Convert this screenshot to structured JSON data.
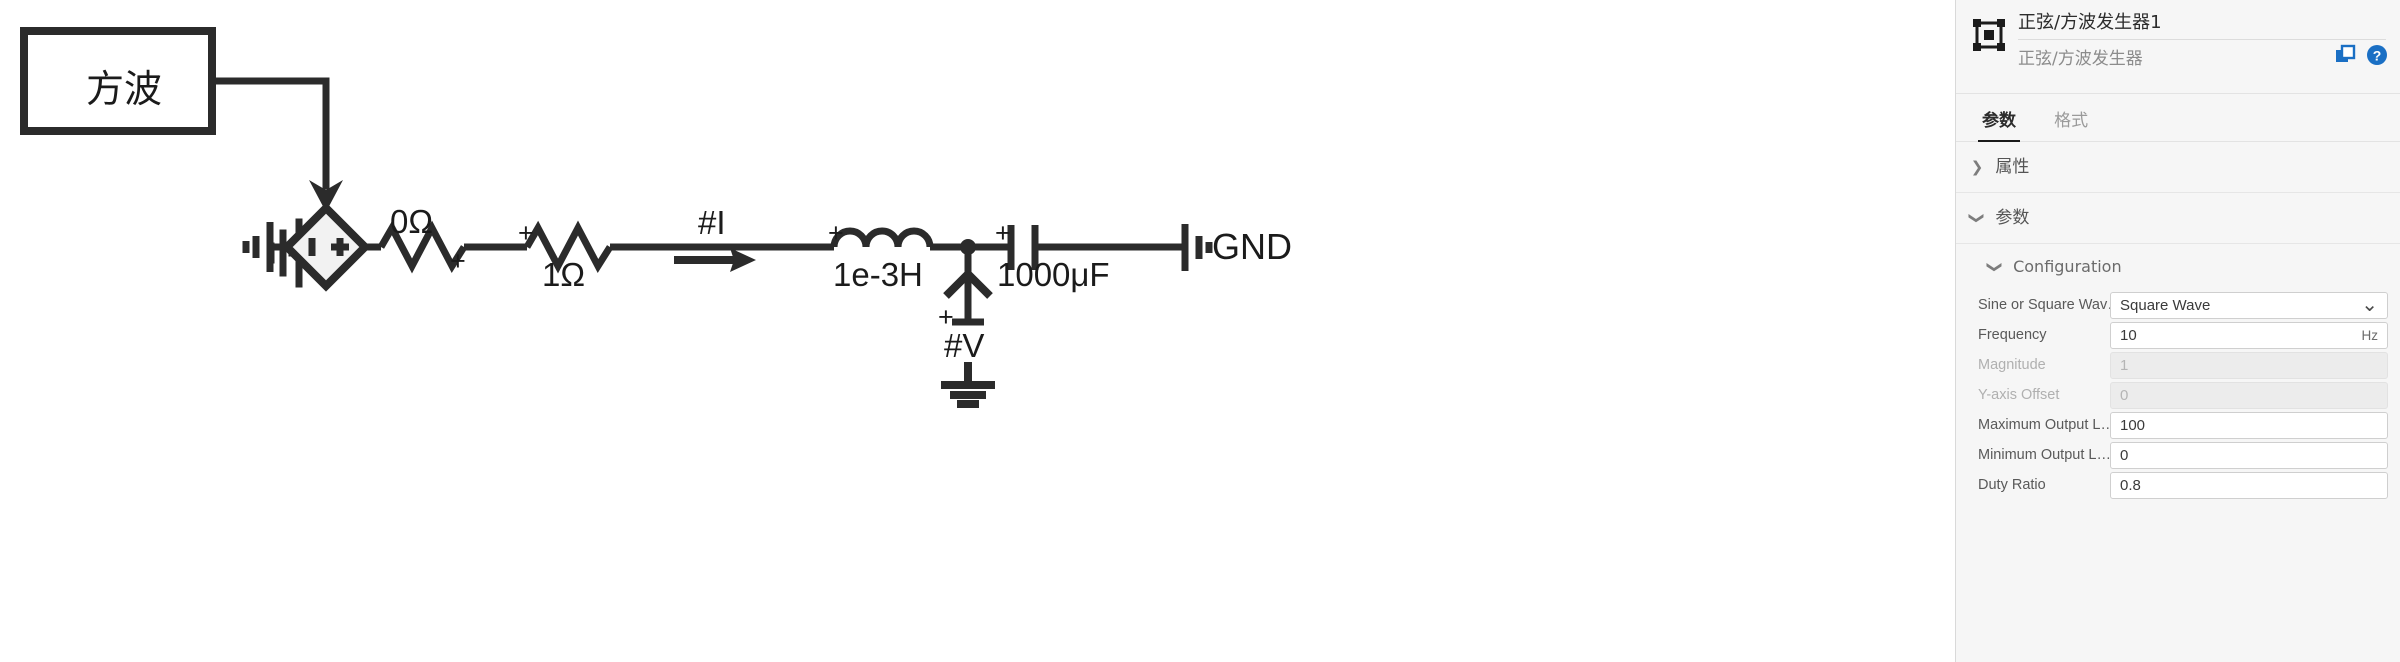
{
  "canvas": {
    "source_block": {
      "label": "方波"
    },
    "components": [
      {
        "name": "voltage-source",
        "symbol": "diamond",
        "inner": "−|+"
      },
      {
        "name": "resistor-0ohm",
        "value_label": "0Ω",
        "polarity": "+"
      },
      {
        "name": "resistor-1ohm",
        "value_label": "1Ω",
        "polarity": "+"
      },
      {
        "name": "current-probe",
        "label": "#I"
      },
      {
        "name": "inductor",
        "value_label": "1e-3H",
        "polarity": "+"
      },
      {
        "name": "capacitor",
        "value_label": "1000μF",
        "polarity": "+"
      },
      {
        "name": "voltage-probe",
        "label": "#V",
        "polarity": "+"
      },
      {
        "name": "ground-right",
        "label": "GND"
      }
    ],
    "labels": {
      "r0": "0Ω",
      "r1": "1Ω",
      "current": "#I",
      "inductor": "1e-3H",
      "capacitor": "1000μF",
      "voltage": "#V",
      "gnd": "GND",
      "plus": "+"
    }
  },
  "panel": {
    "header": {
      "icon": "component-block-icon",
      "title": "正弦/方波发生器1",
      "subtitle": "正弦/方波发生器",
      "actions": [
        {
          "name": "duplicate-icon",
          "label": "duplicate"
        },
        {
          "name": "help-icon",
          "label": "help"
        }
      ]
    },
    "tabs": [
      {
        "label": "参数",
        "active": true
      },
      {
        "label": "格式",
        "active": false
      }
    ],
    "sections": [
      {
        "name": "properties",
        "label": "属性",
        "expanded": false
      },
      {
        "name": "parameters",
        "label": "参数",
        "expanded": true
      },
      {
        "name": "configuration",
        "label": "Configuration",
        "expanded": true
      }
    ],
    "params": [
      {
        "label": "Sine or Square Wav…",
        "value": "Square Wave",
        "unit": "",
        "type": "select",
        "disabled": false
      },
      {
        "label": "Frequency",
        "value": "10",
        "unit": "Hz",
        "type": "text",
        "disabled": false
      },
      {
        "label": "Magnitude",
        "value": "1",
        "unit": "",
        "type": "text",
        "disabled": true
      },
      {
        "label": "Y-axis Offset",
        "value": "0",
        "unit": "",
        "type": "text",
        "disabled": true
      },
      {
        "label": "Maximum Output L…",
        "value": "100",
        "unit": "",
        "type": "text",
        "disabled": false
      },
      {
        "label": "Minimum Output L…",
        "value": "0",
        "unit": "",
        "type": "text",
        "disabled": false
      },
      {
        "label": "Duty Ratio",
        "value": "0.8",
        "unit": "",
        "type": "text",
        "disabled": false
      }
    ]
  },
  "colors": {
    "accent_blue": "#1a6fc4",
    "wire": "#2b2b2b",
    "panel_bg": "#f6f6f6"
  }
}
